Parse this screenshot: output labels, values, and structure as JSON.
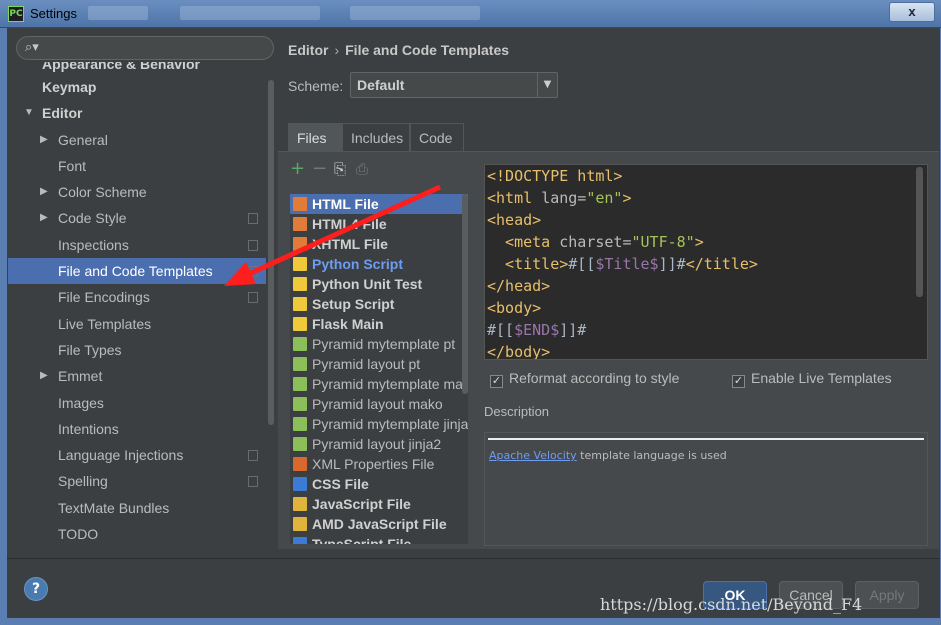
{
  "window": {
    "title": "Settings",
    "close_label": "x"
  },
  "search": {
    "placeholder": ""
  },
  "sidebar": {
    "items": [
      {
        "label": "Appearance & Behavior",
        "level": 0,
        "bold": true,
        "arrow": "",
        "copy": false
      },
      {
        "label": "Keymap",
        "level": 0,
        "bold": true,
        "arrow": "",
        "copy": false
      },
      {
        "label": "Editor",
        "level": 0,
        "bold": true,
        "arrow": "expanded",
        "copy": false
      },
      {
        "label": "General",
        "level": 1,
        "arrow": "collapsed",
        "copy": false
      },
      {
        "label": "Font",
        "level": 1,
        "arrow": "",
        "copy": false
      },
      {
        "label": "Color Scheme",
        "level": 1,
        "arrow": "collapsed",
        "copy": false
      },
      {
        "label": "Code Style",
        "level": 1,
        "arrow": "collapsed",
        "copy": true
      },
      {
        "label": "Inspections",
        "level": 1,
        "arrow": "",
        "copy": true
      },
      {
        "label": "File and Code Templates",
        "level": 1,
        "arrow": "",
        "copy": true,
        "selected": true
      },
      {
        "label": "File Encodings",
        "level": 1,
        "arrow": "",
        "copy": true
      },
      {
        "label": "Live Templates",
        "level": 1,
        "arrow": "",
        "copy": false
      },
      {
        "label": "File Types",
        "level": 1,
        "arrow": "",
        "copy": false
      },
      {
        "label": "Emmet",
        "level": 1,
        "arrow": "collapsed",
        "copy": false
      },
      {
        "label": "Images",
        "level": 1,
        "arrow": "",
        "copy": false
      },
      {
        "label": "Intentions",
        "level": 1,
        "arrow": "",
        "copy": false
      },
      {
        "label": "Language Injections",
        "level": 1,
        "arrow": "",
        "copy": true
      },
      {
        "label": "Spelling",
        "level": 1,
        "arrow": "",
        "copy": true
      },
      {
        "label": "TextMate Bundles",
        "level": 1,
        "arrow": "",
        "copy": false
      },
      {
        "label": "TODO",
        "level": 1,
        "arrow": "",
        "copy": false
      }
    ]
  },
  "breadcrumb": {
    "parent": "Editor",
    "separator": "›",
    "current": "File and Code Templates"
  },
  "scheme": {
    "label": "Scheme:",
    "value": "Default"
  },
  "tabs": [
    {
      "label": "Files",
      "active": true
    },
    {
      "label": "Includes"
    },
    {
      "label": "Code"
    }
  ],
  "templates": [
    {
      "label": "HTML File",
      "bold": true,
      "selected": true,
      "icon_color": "#e07b39"
    },
    {
      "label": "HTML4 File",
      "bold": true,
      "icon_color": "#e07b39"
    },
    {
      "label": "XHTML File",
      "bold": true,
      "icon_color": "#e07b39"
    },
    {
      "label": "Python Script",
      "bold": true,
      "blue": true,
      "icon_color": "#f0c93b"
    },
    {
      "label": "Python Unit Test",
      "bold": true,
      "icon_color": "#f0c93b"
    },
    {
      "label": "Setup Script",
      "bold": true,
      "icon_color": "#f0c93b"
    },
    {
      "label": "Flask Main",
      "bold": true,
      "icon_color": "#f0c93b"
    },
    {
      "label": "Pyramid mytemplate pt",
      "icon_color": "#8cbf5a"
    },
    {
      "label": "Pyramid layout pt",
      "icon_color": "#8cbf5a"
    },
    {
      "label": "Pyramid mytemplate mako",
      "icon_color": "#8cbf5a"
    },
    {
      "label": "Pyramid layout mako",
      "icon_color": "#8cbf5a"
    },
    {
      "label": "Pyramid mytemplate jinja2",
      "icon_color": "#8cbf5a"
    },
    {
      "label": "Pyramid layout jinja2",
      "icon_color": "#8cbf5a"
    },
    {
      "label": "XML Properties File",
      "icon_color": "#d9682f"
    },
    {
      "label": "CSS File",
      "bold": true,
      "icon_color": "#3b7bd5"
    },
    {
      "label": "JavaScript File",
      "bold": true,
      "icon_color": "#e0b43a"
    },
    {
      "label": "AMD JavaScript File",
      "bold": true,
      "icon_color": "#e0b43a"
    },
    {
      "label": "TypeScript File",
      "bold": true,
      "icon_color": "#3b7bd5"
    }
  ],
  "editor": {
    "lines": [
      [
        {
          "t": "<!DOCTYPE html>",
          "c": "tag"
        }
      ],
      [
        {
          "t": "<html ",
          "c": "tag"
        },
        {
          "t": "lang=",
          "c": "attr"
        },
        {
          "t": "\"en\"",
          "c": "str"
        },
        {
          "t": ">",
          "c": "tag"
        }
      ],
      [
        {
          "t": "<head>",
          "c": "tag"
        }
      ],
      [
        {
          "t": "  <meta ",
          "c": "tag"
        },
        {
          "t": "charset=",
          "c": "attr"
        },
        {
          "t": "\"UTF-8\"",
          "c": "str"
        },
        {
          "t": ">",
          "c": "tag"
        }
      ],
      [
        {
          "t": "  <title>",
          "c": "tag"
        },
        {
          "t": "#[[",
          "c": "plain"
        },
        {
          "t": "$Title$",
          "c": "var"
        },
        {
          "t": "]]#",
          "c": "plain"
        },
        {
          "t": "</title>",
          "c": "tag"
        }
      ],
      [
        {
          "t": "</head>",
          "c": "tag"
        }
      ],
      [
        {
          "t": "<body>",
          "c": "tag"
        }
      ],
      [
        {
          "t": "#[[",
          "c": "plain"
        },
        {
          "t": "$END$",
          "c": "var"
        },
        {
          "t": "]]#",
          "c": "plain"
        }
      ],
      [
        {
          "t": "</body>",
          "c": "tag"
        }
      ]
    ]
  },
  "options": {
    "reformat": "Reformat according to style",
    "live": "Enable Live Templates"
  },
  "description": {
    "label": "Description",
    "link": "Apache Velocity",
    "text": " template language is used"
  },
  "buttons": {
    "help": "?",
    "ok": "OK",
    "cancel": "Cancel",
    "apply": "Apply"
  },
  "watermark": "https://blog.csdn.net/Beyond_F4"
}
